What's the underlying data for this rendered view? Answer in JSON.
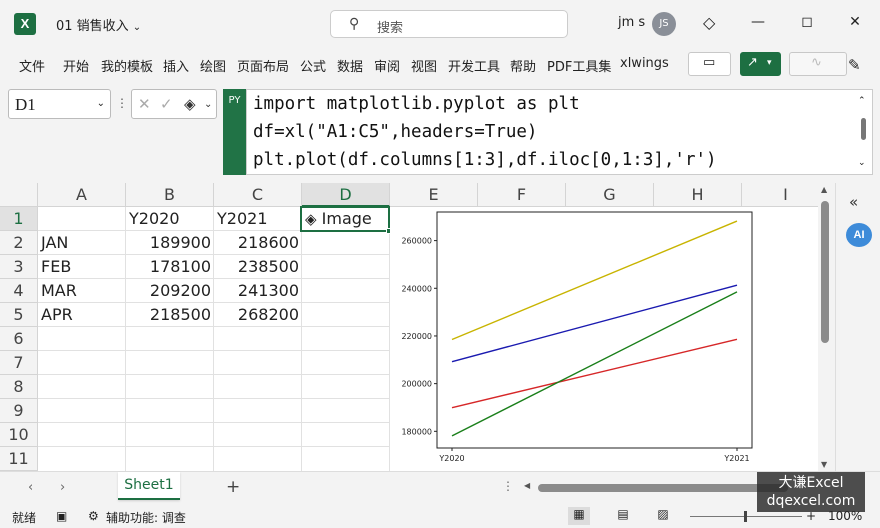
{
  "window": {
    "title": "01 销售收入",
    "search_placeholder": "搜索",
    "user_name": "jm s",
    "avatar_initials": "JS"
  },
  "ribbon": {
    "tabs": [
      "文件",
      "开始",
      "我的模板",
      "插入",
      "绘图",
      "页面布局",
      "公式",
      "数据",
      "审阅",
      "视图",
      "开发工具",
      "帮助",
      "PDF工具集",
      "xlwings"
    ]
  },
  "formula_bar": {
    "name_box": "D1",
    "python_badge": "PY",
    "code_lines": [
      "import matplotlib.pyplot as plt",
      "df=xl(\"A1:C5\",headers=True)",
      "plt.plot(df.columns[1:3],df.iloc[0,1:3],'r')"
    ]
  },
  "grid": {
    "columns": [
      "A",
      "B",
      "C",
      "D",
      "E",
      "F",
      "G",
      "H",
      "I"
    ],
    "rows": [
      "1",
      "2",
      "3",
      "4",
      "5",
      "6",
      "7",
      "8",
      "9",
      "10",
      "11"
    ],
    "header_row": [
      "",
      "Y2020",
      "Y2021"
    ],
    "image_cell_label": "Image",
    "data_rows": [
      [
        "JAN",
        "189900",
        "218600"
      ],
      [
        "FEB",
        "178100",
        "238500"
      ],
      [
        "MAR",
        "209200",
        "241300"
      ],
      [
        "APR",
        "218500",
        "268200"
      ]
    ]
  },
  "chart_data": {
    "type": "line",
    "title": "",
    "xlabel": "",
    "ylabel": "",
    "categories": [
      "Y2020",
      "Y2021"
    ],
    "ylim": [
      173000,
      272000
    ],
    "yticks": [
      180000,
      200000,
      220000,
      240000,
      260000
    ],
    "ytick_labels": [
      "180000",
      "200000",
      "220000",
      "240000",
      "260000"
    ],
    "series": [
      {
        "values": [
          189900,
          218600
        ],
        "color": "#d62728"
      },
      {
        "values": [
          178100,
          238500
        ],
        "color": "#1a7f1a"
      },
      {
        "values": [
          209200,
          241300
        ],
        "color": "#1a1ab0"
      },
      {
        "values": [
          218500,
          268200
        ],
        "color": "#c8b400"
      }
    ],
    "grid": false,
    "legend": "none"
  },
  "sheets": {
    "tabs": [
      "Sheet1"
    ],
    "add_label": "+"
  },
  "status": {
    "ready": "就绪",
    "accessibility": "辅助功能: 调查",
    "zoom": "100%"
  },
  "watermark": {
    "line1": "大谦Excel",
    "line2": "dqexcel.com"
  },
  "colors": {
    "accent": "#1d6f42",
    "python_badge": "#217346"
  }
}
